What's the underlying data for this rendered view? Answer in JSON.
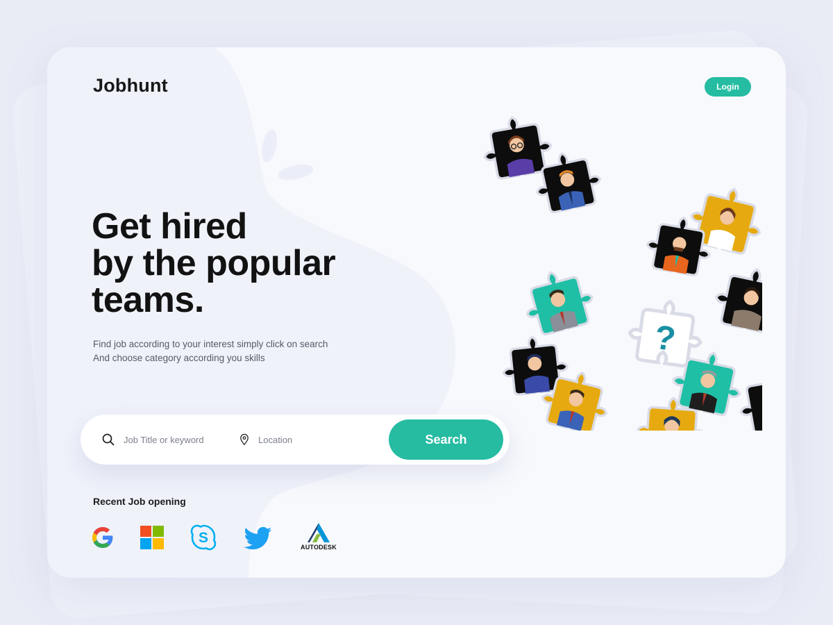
{
  "app": {
    "logo": "Jobhunt",
    "login_label": "Login"
  },
  "hero": {
    "headline_lines": [
      "Get hired",
      "by the popular",
      "teams."
    ],
    "subtitle_lines": [
      "Find job according to your interest simply click on search",
      "And choose category according you skills"
    ]
  },
  "search": {
    "job_placeholder": "Job Title or keyword",
    "location_placeholder": "Location",
    "button_label": "Search"
  },
  "recent": {
    "title": "Recent Job opening",
    "companies": [
      {
        "name": "Google",
        "icon": "google-logo-icon"
      },
      {
        "name": "Microsoft",
        "icon": "microsoft-logo-icon"
      },
      {
        "name": "Skype",
        "icon": "skype-logo-icon"
      },
      {
        "name": "Twitter",
        "icon": "twitter-logo-icon"
      },
      {
        "name": "Autodesk",
        "icon": "autodesk-logo-icon",
        "wordmark": "AUTODESK"
      }
    ]
  },
  "illustration": {
    "question_mark": "?"
  },
  "colors": {
    "accent": "#25bca2",
    "background": "#e9ebf5",
    "card": "#f8f9fd",
    "puzzle_yellow": "#e6aa10",
    "puzzle_teal": "#1fbfa6",
    "puzzle_black": "#0d0d0d"
  }
}
